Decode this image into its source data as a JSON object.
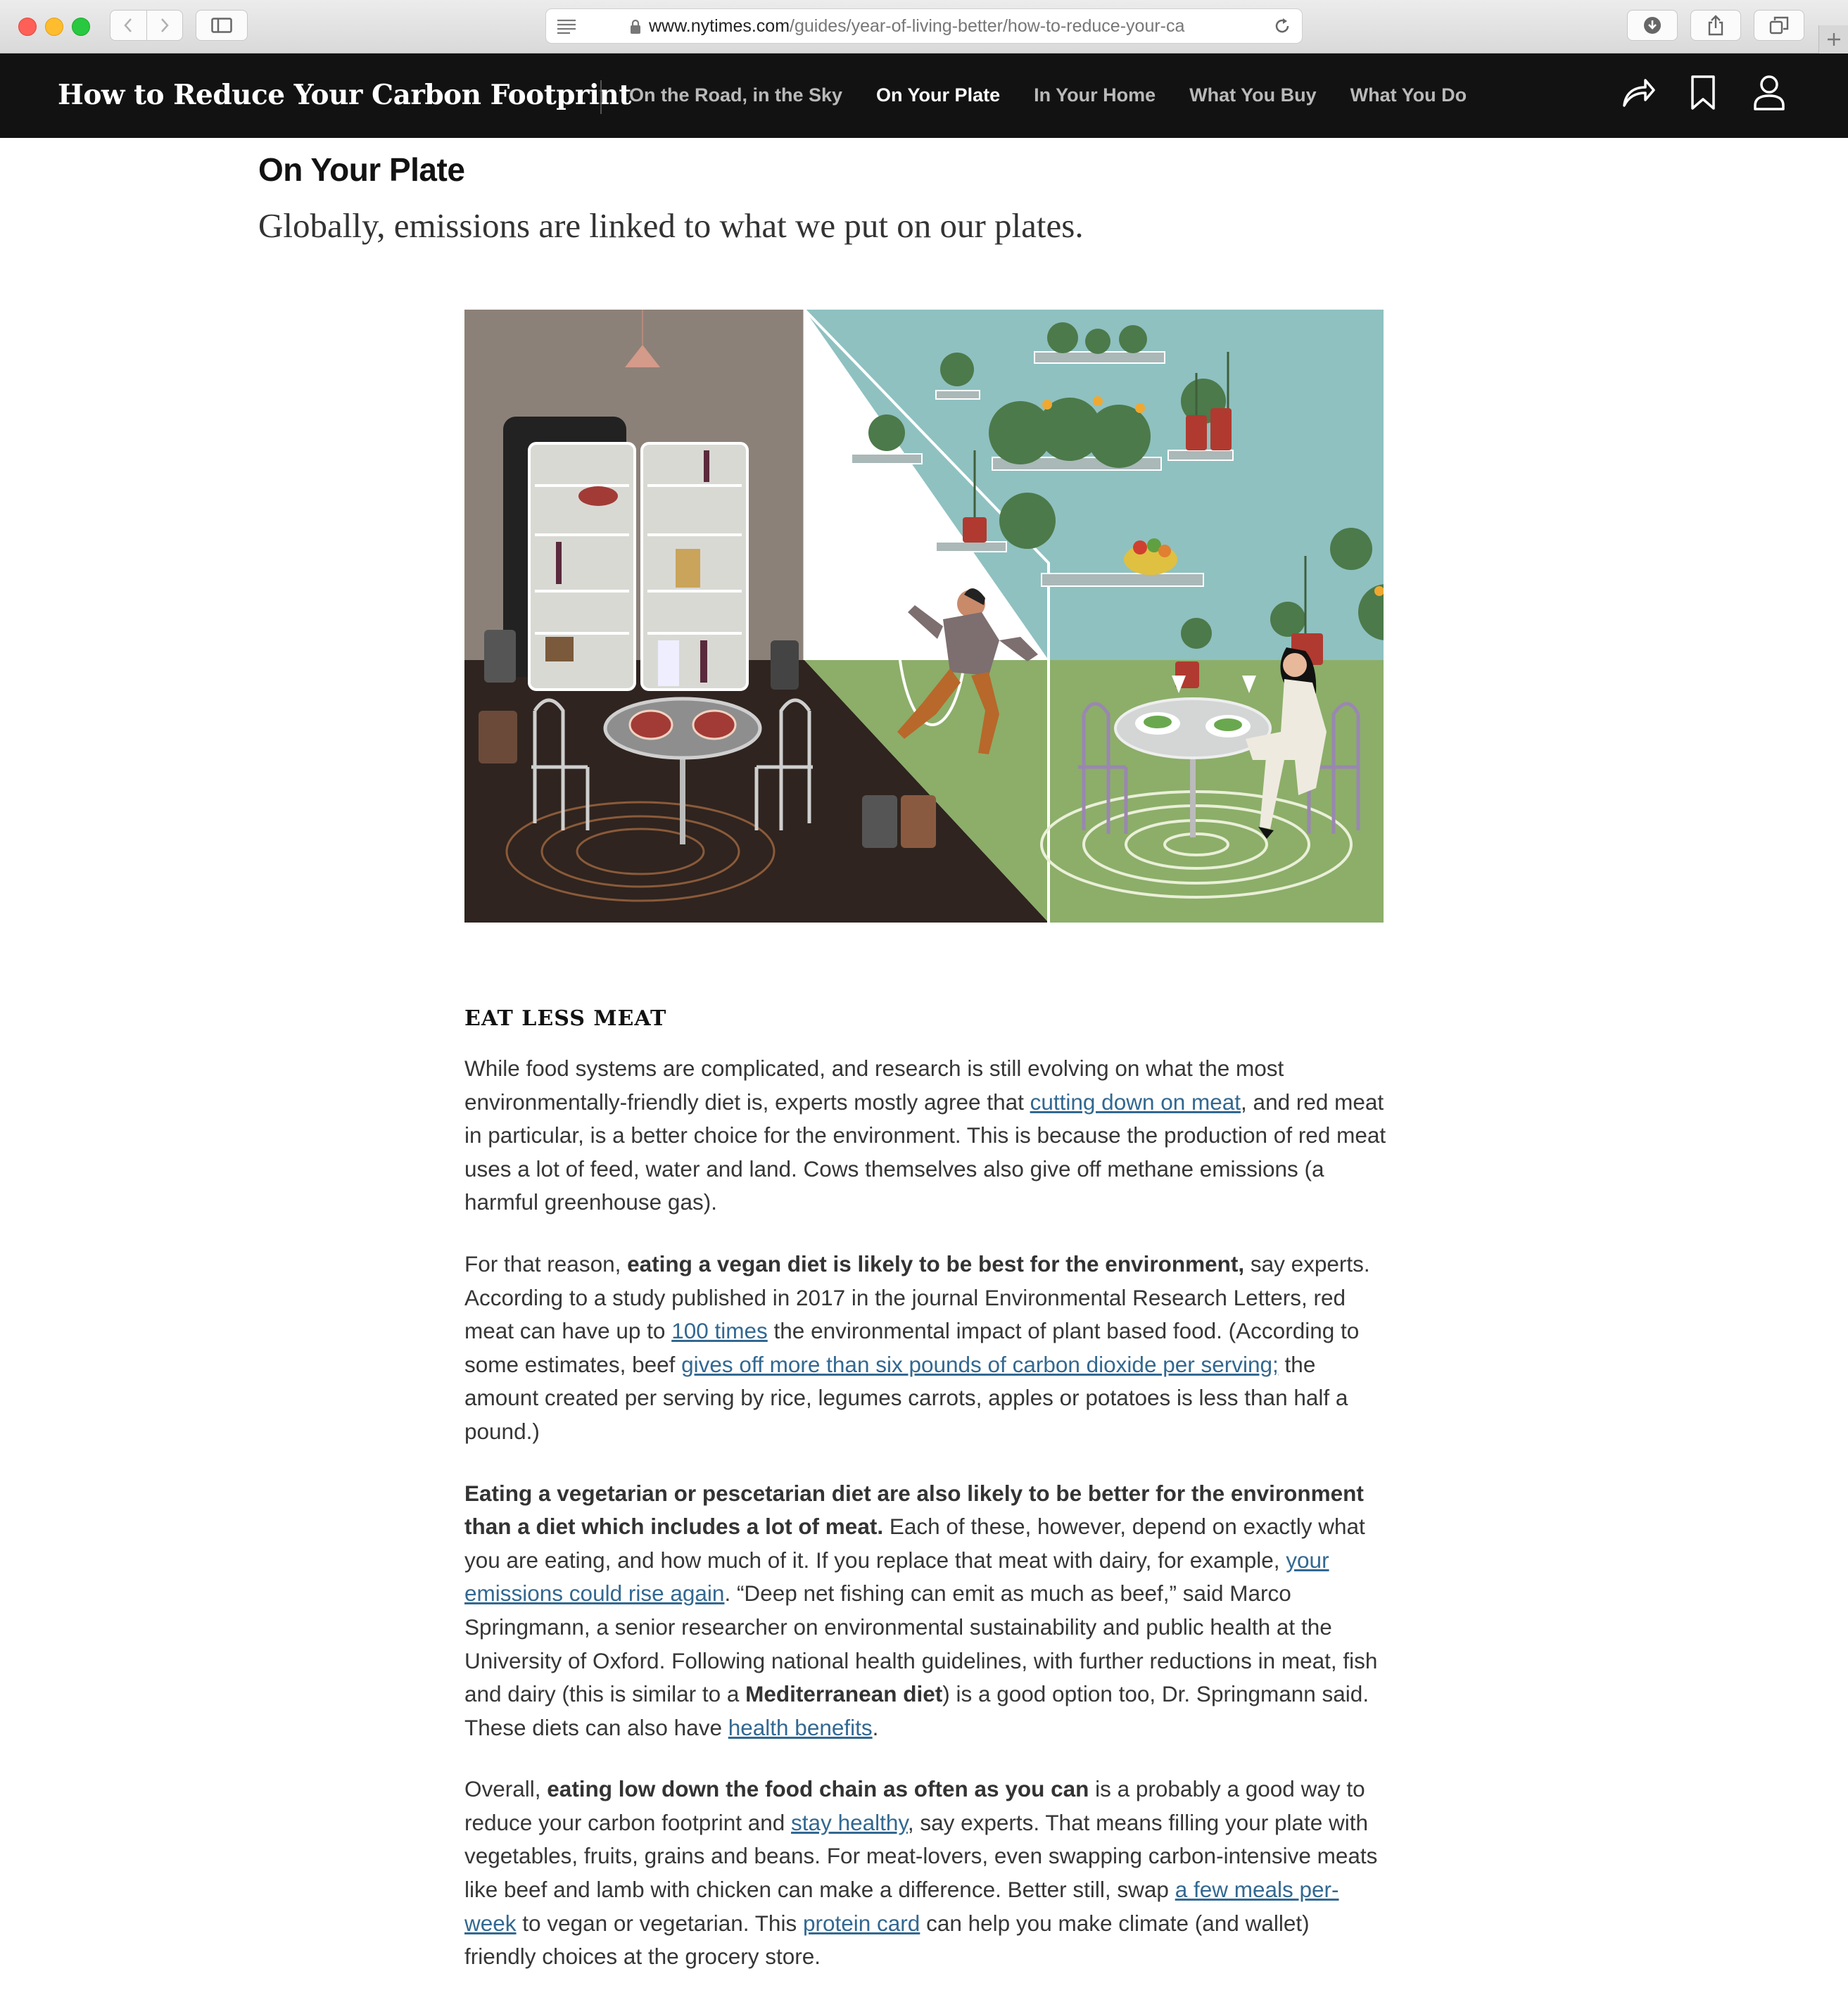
{
  "browser": {
    "url_domain": "www.nytimes.com",
    "url_path": "/guides/year-of-living-better/how-to-reduce-your-ca"
  },
  "header": {
    "site_title": "How to Reduce Your Carbon Footprint",
    "nav": [
      {
        "label": "On the Road, in the Sky",
        "active": false
      },
      {
        "label": "On Your Plate",
        "active": true
      },
      {
        "label": "In Your Home",
        "active": false
      },
      {
        "label": "What You Buy",
        "active": false
      },
      {
        "label": "What You Do",
        "active": false
      }
    ],
    "icons": [
      "share-icon",
      "bookmark-icon",
      "account-icon"
    ]
  },
  "section": {
    "heading": "On Your Plate",
    "subheading": "Globally, emissions are linked to what we put on our plates."
  },
  "article": {
    "kicker": "EAT LESS MEAT",
    "p1": {
      "t1": "While food systems are complicated, and research is still evolving on what the most environmentally-friendly diet is, experts mostly agree that ",
      "link1": "cutting down on meat",
      "t2": ", and red meat in particular, is a better choice for the environment. This is because the production of red meat uses a lot of feed, water and land. Cows themselves also give off methane emissions (a harmful greenhouse gas)."
    },
    "p2": {
      "t1": "For that reason, ",
      "b1": "eating a vegan diet is likely to be best for the environment,",
      "t2": " say experts. According to a study published in 2017 in the journal Environmental Research Letters, red meat can have up to ",
      "link1": "100 times",
      "t3": " the environmental impact of plant based food. (According to some estimates, beef ",
      "link2": "gives off more than six pounds of carbon dioxide per serving;",
      "t4": " the amount created per serving by rice, legumes carrots, apples or potatoes is less than half a pound.)"
    },
    "p3": {
      "b1": "Eating a vegetarian or pescetarian diet are also likely to be better for the environment than a diet which includes a lot of meat.",
      "t1": " Each of these, however, depend on exactly what you are eating, and how much of it. If you replace that meat with dairy, for example, ",
      "link1": "your emissions could rise again",
      "t2": ". “Deep net fishing can emit as much as beef,” said Marco Springmann, a senior researcher on environmental sustainability and public health at the University of Oxford. Following national health guidelines, with further reductions in meat, fish and dairy (this is similar to a ",
      "b2": "Mediterranean diet",
      "t3": ") is a good option too, Dr. Springmann said. These diets can also have ",
      "link2": "health benefits",
      "t4": "."
    },
    "p4": {
      "t1": "Overall, ",
      "b1": "eating low down the food chain as often as you can",
      "t2": " is a probably a good way to reduce your carbon footprint and ",
      "link1": "stay healthy",
      "t3": ", say experts. That means filling your plate with vegetables, fruits, grains and beans. For meat-lovers, even swapping carbon-intensive meats like beef and lamb with chicken can make a difference. Better still, swap ",
      "link2": "a few meals per-week",
      "t4": " to vegan or vegetarian. This ",
      "link3": "protein card",
      "t5": " can help you make climate (and wallet) friendly choices at the grocery store."
    }
  },
  "colors": {
    "nav_bg": "#121212",
    "link": "#326891",
    "body_text": "#363636",
    "illus_wall_left": "#8c8178",
    "illus_wall_right": "#8fc1c1",
    "illus_floor_left": "#2f241f",
    "illus_floor_right": "#8cae69"
  }
}
